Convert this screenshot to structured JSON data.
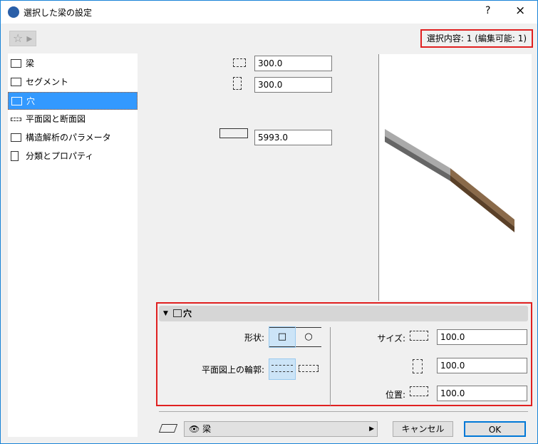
{
  "window": {
    "title": "選択した梁の設定",
    "help": "?",
    "close": "×"
  },
  "toolbar": {
    "favorites": "☆ ▸",
    "selection_info": "選択内容: 1 (編集可能: 1)"
  },
  "sidebar": {
    "items": [
      {
        "label": "梁"
      },
      {
        "label": "セグメント"
      },
      {
        "label": "穴",
        "selected": true
      },
      {
        "label": "平面図と断面図"
      },
      {
        "label": "構造解析のパラメータ"
      },
      {
        "label": "分類とプロパティ"
      }
    ]
  },
  "geometry": {
    "width": "300.0",
    "height": "300.0",
    "length": "5993.0"
  },
  "hole_panel": {
    "title": "穴",
    "shape_label": "形状:",
    "shape_options": [
      "□",
      "○"
    ],
    "shape_selected": 0,
    "contour_label": "平面図上の輪郭:",
    "contour_selected": 0,
    "size_label": "サイズ:",
    "size_width": "100.0",
    "size_height": "100.0",
    "position_label": "位置:",
    "position": "100.0"
  },
  "footer": {
    "layer": "梁",
    "cancel": "キャンセル",
    "ok": "OK"
  }
}
